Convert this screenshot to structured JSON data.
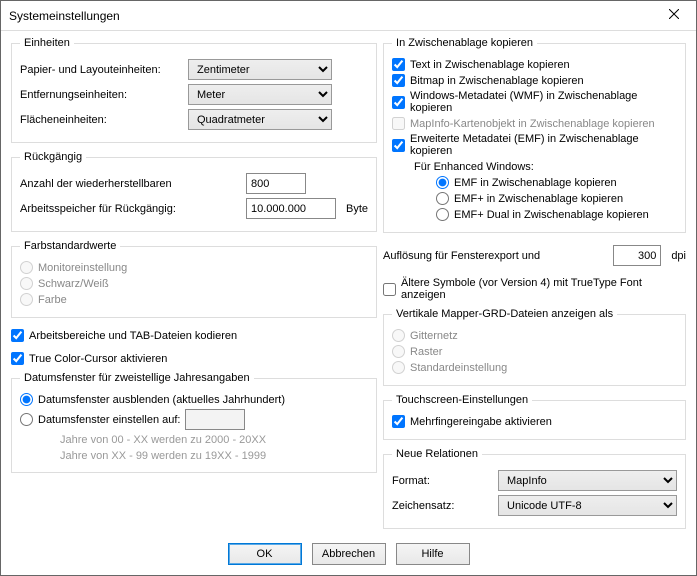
{
  "window": {
    "title": "Systemeinstellungen"
  },
  "units": {
    "legend": "Einheiten",
    "paper": {
      "label": "Papier- und Layouteinheiten:",
      "value": "Zentimeter"
    },
    "distance": {
      "label": "Entfernungseinheiten:",
      "value": "Meter"
    },
    "area": {
      "label": "Flächeneinheiten:",
      "value": "Quadratmeter"
    }
  },
  "undo": {
    "legend": "Rückgängig",
    "count": {
      "label": "Anzahl der wiederherstellbaren",
      "value": "800"
    },
    "memory": {
      "label": "Arbeitsspeicher für Rückgängig:",
      "value": "10.000.000",
      "unit": "Byte"
    }
  },
  "colors": {
    "legend": "Farbstandardwerte",
    "options": [
      "Monitoreinstellung",
      "Schwarz/Weiß",
      "Farbe"
    ]
  },
  "misc": {
    "encode_workspaces": "Arbeitsbereiche und TAB-Dateien kodieren",
    "true_color_cursor": "True Color-Cursor aktivieren"
  },
  "datewin": {
    "legend": "Datumsfenster für zweistellige Jahresangaben",
    "hide": "Datumsfenster ausblenden (aktuelles Jahrhundert)",
    "set": "Datumsfenster einstellen auf:",
    "note1": "Jahre von 00 - XX werden zu 2000 - 20XX",
    "note2": "Jahre von XX - 99 werden zu 19XX - 1999"
  },
  "clipboard": {
    "legend": "In Zwischenablage kopieren",
    "text": "Text in Zwischenablage kopieren",
    "bitmap": "Bitmap in Zwischenablage kopieren",
    "wmf": "Windows-Metadatei (WMF) in Zwischenablage kopieren",
    "mapobj": "MapInfo-Kartenobjekt in Zwischenablage kopieren",
    "emf": "Erweiterte Metadatei (EMF) in Zwischenablage kopieren",
    "emf_sub": "Für Enhanced Windows:",
    "emf_opts": [
      "EMF in Zwischenablage kopieren",
      "EMF+ in Zwischenablage kopieren",
      "EMF+ Dual in Zwischenablage kopieren"
    ]
  },
  "resolution": {
    "label": "Auflösung für Fensterexport und",
    "value": "300",
    "unit": "dpi"
  },
  "old_symbols": "Ältere Symbole (vor Version 4) mit TrueType Font anzeigen",
  "grd": {
    "legend": "Vertikale Mapper-GRD-Dateien anzeigen als",
    "options": [
      "Gitternetz",
      "Raster",
      "Standardeinstellung"
    ]
  },
  "touch": {
    "legend": "Touchscreen-Einstellungen",
    "multitouch": "Mehrfingereingabe aktivieren"
  },
  "relations": {
    "legend": "Neue Relationen",
    "format": {
      "label": "Format:",
      "value": "MapInfo"
    },
    "charset": {
      "label": "Zeichensatz:",
      "value": "Unicode UTF-8"
    }
  },
  "buttons": {
    "ok": "OK",
    "cancel": "Abbrechen",
    "help": "Hilfe"
  }
}
